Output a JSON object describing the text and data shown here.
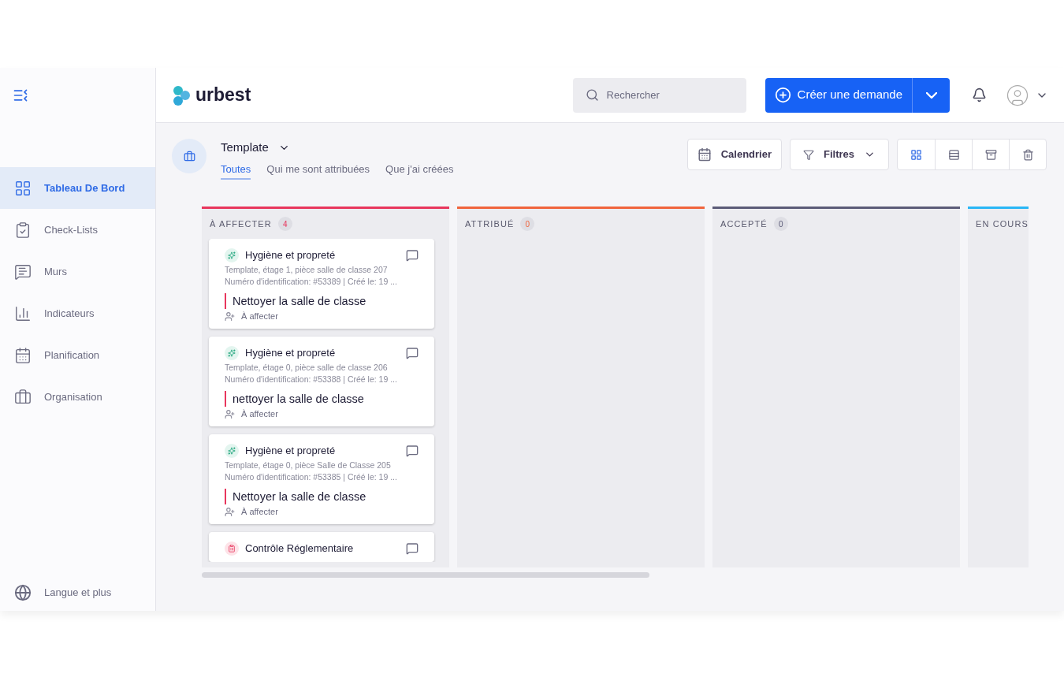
{
  "sidebar": {
    "items": [
      {
        "label": "Tableau De Bord",
        "selected": true
      },
      {
        "label": "Check-Lists",
        "selected": false
      },
      {
        "label": "Murs",
        "selected": false
      },
      {
        "label": "Indicateurs",
        "selected": false
      },
      {
        "label": "Planification",
        "selected": false
      },
      {
        "label": "Organisation",
        "selected": false
      }
    ],
    "footer": "Langue et plus"
  },
  "header": {
    "logo": "urbest",
    "search": {
      "placeholder": "Rechercher"
    },
    "create_button": "Créer une demande"
  },
  "board": {
    "title": "Template",
    "tabs": [
      {
        "label": "Toutes",
        "selected": true
      },
      {
        "label": "Qui me sont attribuées",
        "selected": false
      },
      {
        "label": "Que j'ai créées",
        "selected": false
      }
    ],
    "calendar_button": "Calendrier",
    "filter_button": "Filtres",
    "views": [
      {
        "selected": true
      },
      {
        "selected": false
      },
      {
        "selected": false
      },
      {
        "selected": false
      }
    ],
    "columns": [
      {
        "title": "À AFFECTER",
        "count": "4",
        "color": "#e8365d",
        "cards": [
          {
            "kind": "hygiene",
            "category": "Hygiène et propreté",
            "location": "Template, étage 1, pièce salle de classe 207",
            "meta": "Numéro d'identification: #53389 | Créé le: 19 ...",
            "title": "Nettoyer la salle de classe",
            "assignee": "À affecter"
          },
          {
            "kind": "hygiene",
            "category": "Hygiène et propreté",
            "location": "Template, étage 0, pièce salle de classe 206",
            "meta": "Numéro d'identification: #53388 | Créé le: 19 ...",
            "title": "nettoyer la salle de classe",
            "assignee": "À affecter"
          },
          {
            "kind": "hygiene",
            "category": "Hygiène et propreté",
            "location": "Template, étage 0, pièce Salle de Classe 205",
            "meta": "Numéro d'identification: #53385 | Créé le: 19 ...",
            "title": "Nettoyer la salle de classe",
            "assignee": "À affecter"
          },
          {
            "kind": "regulatory",
            "category": "Contrôle Réglementaire"
          }
        ]
      },
      {
        "title": "ATTRIBUÉ",
        "count": "0",
        "color": "#f0643c"
      },
      {
        "title": "ACCEPTÉ",
        "count": "0",
        "color": "#5b5b78"
      },
      {
        "title": "EN COURS",
        "color": "#29b6f6"
      }
    ]
  }
}
